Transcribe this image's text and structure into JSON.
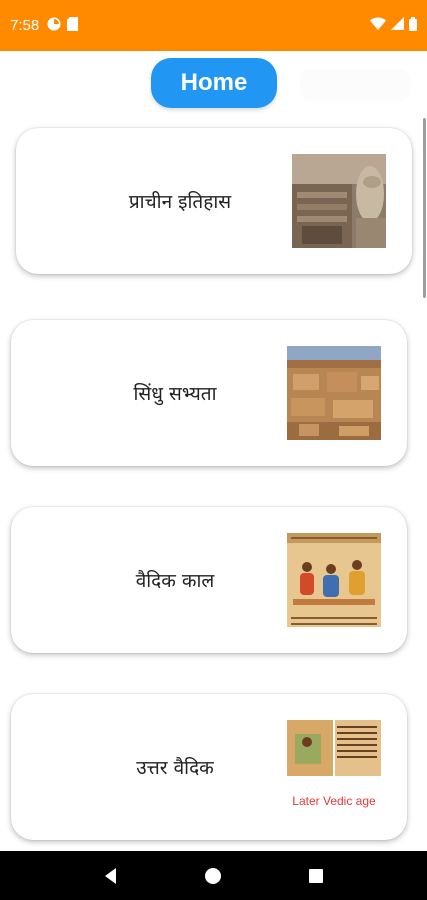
{
  "status_bar": {
    "time": "7:58",
    "icons": [
      "app-notification-icon",
      "sim-card-icon",
      "wifi-icon",
      "signal-icon",
      "battery-icon"
    ]
  },
  "header": {
    "home_label": "Home"
  },
  "cards": [
    {
      "title": "प्राचीन इतिहास",
      "image": "ancient-ruins-thumbnail"
    },
    {
      "title": "सिंधु सभ्यता",
      "image": "indus-city-thumbnail"
    },
    {
      "title": "वैदिक काल",
      "image": "vedic-painting-thumbnail"
    },
    {
      "title": "उत्तर वैदिक",
      "image": "later-vedic-manuscript-thumbnail",
      "image_caption": "Later Vedic age"
    }
  ],
  "nav_bar": {
    "buttons": [
      "back",
      "home",
      "recents"
    ]
  },
  "colors": {
    "status_bar": "#ff8a00",
    "home_button": "#2196f3",
    "caption_red": "#e53935"
  }
}
